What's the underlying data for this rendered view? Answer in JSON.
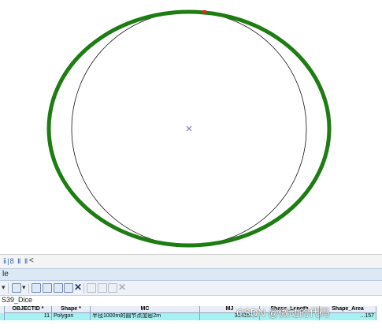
{
  "nav_strip": {
    "text": "ⅱ|8 Ⅱ Ⅱ",
    "back": "<"
  },
  "title_strip": {
    "text": "le"
  },
  "tab_strip": {
    "text": "S39_Dice"
  },
  "table": {
    "columns": [
      "OBJECTID *",
      "Shape *",
      "MC",
      "MJ",
      "Shape_Length",
      "Shape_Area"
    ],
    "rows": [
      [
        "11",
        "Polygon",
        "半径1000m的圆节点加密2m",
        "314157...",
        "",
        "...157"
      ]
    ]
  },
  "watermark": "CSDN @微动的代码",
  "colors": {
    "polygon_outline": "#1e7d12",
    "reference_circle": "#000000",
    "center_marker": "#6a6ab8",
    "vertex_marker": "#e8231f",
    "selected_row": "#a6f2f3"
  }
}
